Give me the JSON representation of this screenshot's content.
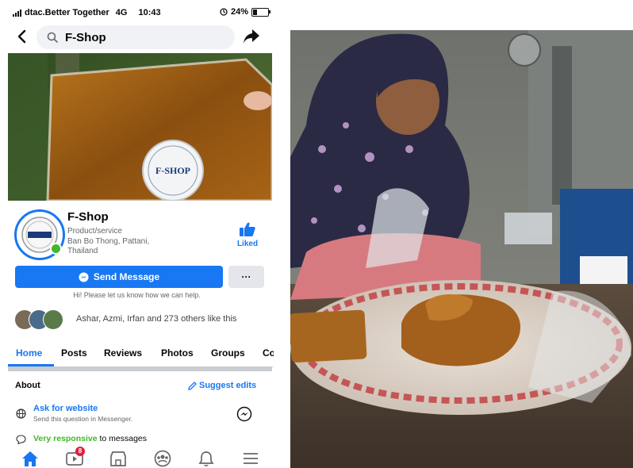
{
  "status_bar": {
    "carrier": "dtac.Better Together",
    "network": "4G",
    "time": "10:43",
    "battery": "24%"
  },
  "search": {
    "query": "F-Shop"
  },
  "cover": {
    "label_brand": "F-SHOP"
  },
  "page": {
    "name": "F-Shop",
    "category": "Product/service",
    "location": "Ban Bo Thong, Pattani, Thailand",
    "liked_label": "Liked"
  },
  "actions": {
    "send_message": "Send Message",
    "more": "···"
  },
  "greeting": "Hi! Please let us know how we can help.",
  "likes_text": "Ashar, Azmi, Irfan and 273 others like this",
  "tabs": [
    {
      "label": "Home"
    },
    {
      "label": "Posts"
    },
    {
      "label": "Reviews"
    },
    {
      "label": "Photos"
    },
    {
      "label": "Groups"
    },
    {
      "label": "Co"
    }
  ],
  "about": {
    "title": "About",
    "suggest_edits": "Suggest edits",
    "ask_title": "Ask for website",
    "ask_sub": "Send this question in Messenger.",
    "responsive_green": "Very responsive",
    "responsive_rest": " to messages"
  },
  "bottom_nav": {
    "video_badge": "8"
  },
  "colors": {
    "accent": "#1877f2",
    "green": "#42b72a",
    "badge": "#e41e3f"
  }
}
